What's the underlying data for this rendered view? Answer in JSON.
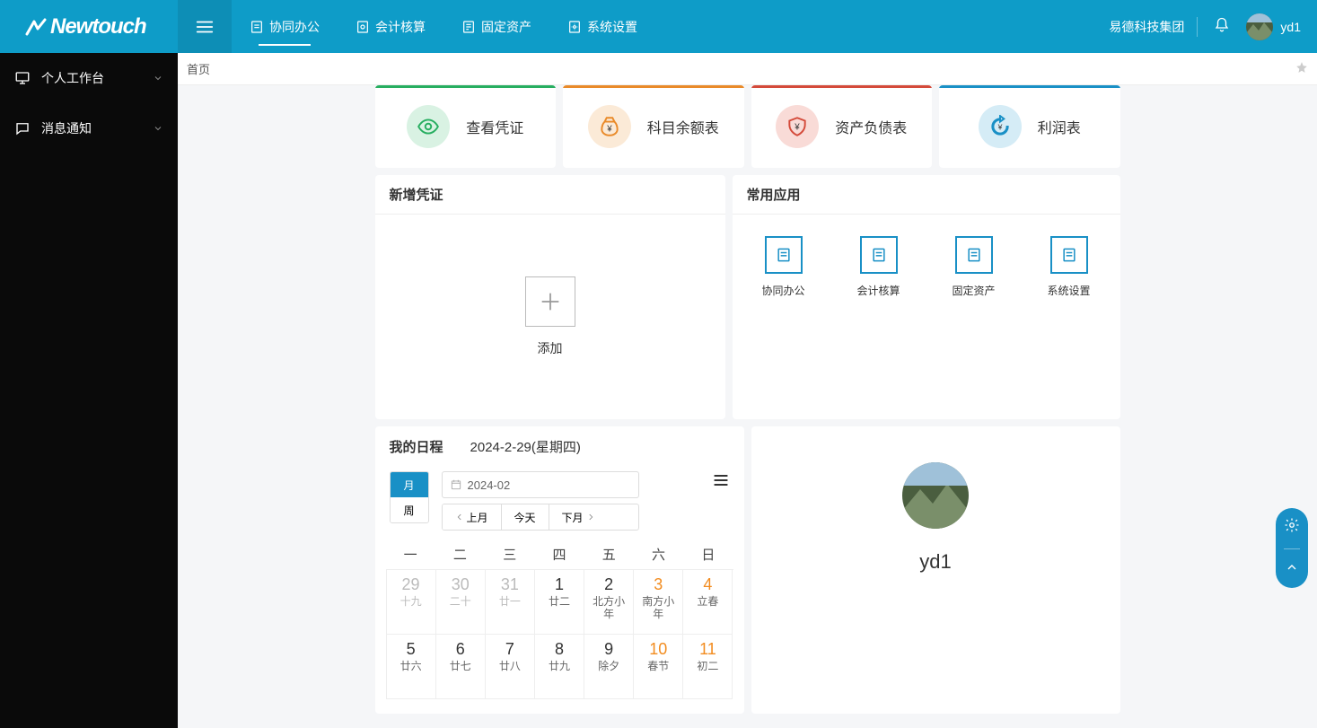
{
  "brand": "Newtouch",
  "company": "易德科技集团",
  "username": "yd1",
  "topnav": [
    {
      "label": "协同办公"
    },
    {
      "label": "会计核算"
    },
    {
      "label": "固定资产"
    },
    {
      "label": "系统设置"
    }
  ],
  "sidebar": [
    {
      "label": "个人工作台"
    },
    {
      "label": "消息通知"
    }
  ],
  "breadcrumb": "首页",
  "shortcut_cards": [
    {
      "label": "查看凭证",
      "bar": "#27ae60",
      "bg": "#d9f2e3",
      "fg": "#27ae60",
      "icon": "eye"
    },
    {
      "label": "科目余额表",
      "bar": "#e98a29",
      "bg": "#fbead7",
      "fg": "#e98a29",
      "icon": "money-bag"
    },
    {
      "label": "资产负债表",
      "bar": "#d44a3a",
      "bg": "#f9dbd7",
      "fg": "#d44a3a",
      "icon": "yen-shield"
    },
    {
      "label": "利润表",
      "bar": "#1990c6",
      "bg": "#d5ecf6",
      "fg": "#1990c6",
      "icon": "yen-refresh"
    }
  ],
  "panels": {
    "new_voucher": {
      "title": "新增凭证",
      "add_label": "添加"
    },
    "common_apps": {
      "title": "常用应用",
      "items": [
        {
          "label": "协同办公"
        },
        {
          "label": "会计核算"
        },
        {
          "label": "固定资产"
        },
        {
          "label": "系统设置"
        }
      ]
    },
    "schedule": {
      "title": "我的日程",
      "date_text": "2024-2-29(星期四)",
      "view_month": "月",
      "view_week": "周",
      "date_value": "2024-02",
      "nav_prev": "上月",
      "nav_today": "今天",
      "nav_next": "下月",
      "weekdays": [
        "一",
        "二",
        "三",
        "四",
        "五",
        "六",
        "日"
      ],
      "rows": [
        [
          {
            "num": "29",
            "lab": "十九",
            "fade": true
          },
          {
            "num": "30",
            "lab": "二十",
            "fade": true
          },
          {
            "num": "31",
            "lab": "廿一",
            "fade": true
          },
          {
            "num": "1",
            "lab": "廿二"
          },
          {
            "num": "2",
            "lab": "北方小\n年"
          },
          {
            "num": "3",
            "lab": "南方小\n年",
            "special": true
          },
          {
            "num": "4",
            "lab": "立春",
            "special": true
          }
        ],
        [
          {
            "num": "5",
            "lab": "廿六"
          },
          {
            "num": "6",
            "lab": "廿七"
          },
          {
            "num": "7",
            "lab": "廿八"
          },
          {
            "num": "8",
            "lab": "廿九"
          },
          {
            "num": "9",
            "lab": "除夕"
          },
          {
            "num": "10",
            "lab": "春节",
            "special": true
          },
          {
            "num": "11",
            "lab": "初二",
            "special": true
          }
        ]
      ]
    },
    "profile": {
      "name": "yd1"
    }
  }
}
